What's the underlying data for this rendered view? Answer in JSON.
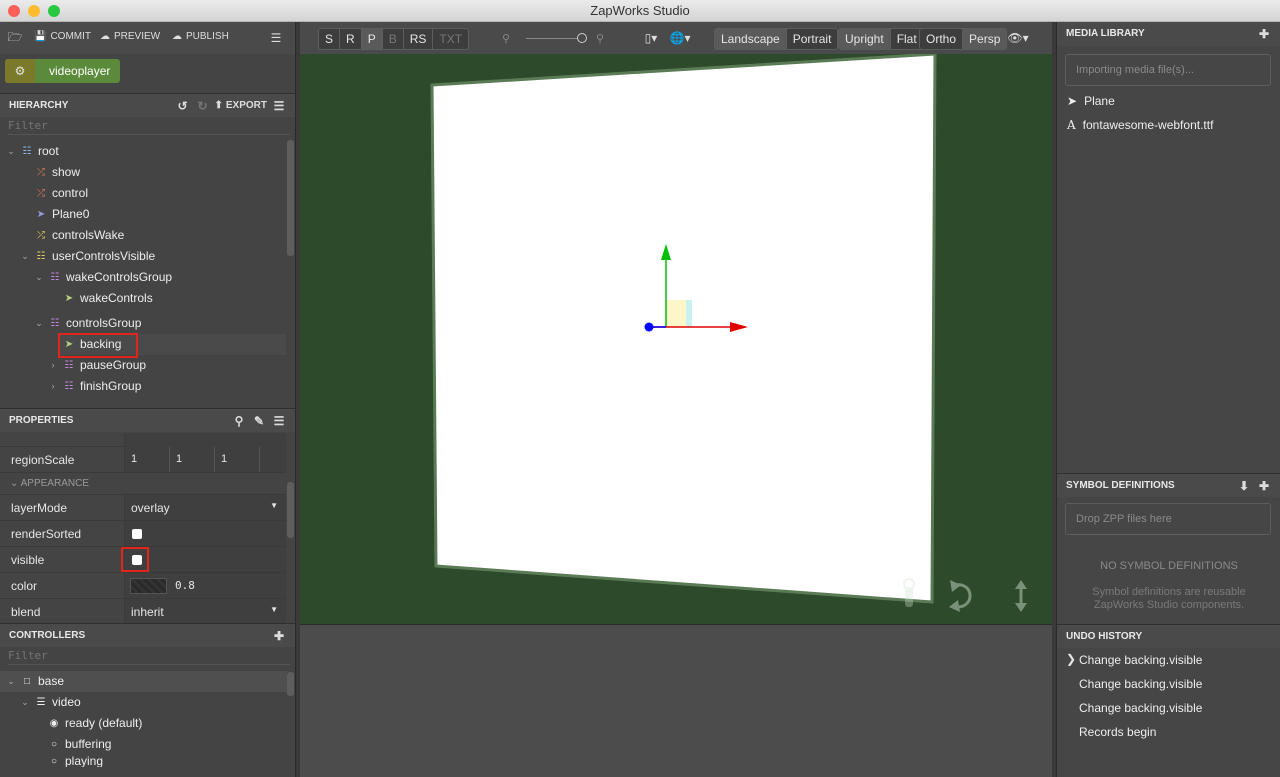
{
  "window": {
    "title": "ZapWorks Studio"
  },
  "top_actions": {
    "commit": "COMMIT",
    "preview": "PREVIEW",
    "publish": "PUBLISH"
  },
  "project": {
    "name": "videoplayer"
  },
  "hierarchy": {
    "title": "HIERARCHY",
    "export": "EXPORT",
    "filter_placeholder": "Filter",
    "items": [
      {
        "label": "root",
        "icon": "group-icon"
      },
      {
        "label": "show",
        "icon": "shuffle-icon"
      },
      {
        "label": "control",
        "icon": "shuffle-icon"
      },
      {
        "label": "Plane0",
        "icon": "rocket-icon"
      },
      {
        "label": "controlsWake",
        "icon": "shuffle-icon"
      },
      {
        "label": "userControlsVisible",
        "icon": "group-icon"
      },
      {
        "label": "wakeControlsGroup",
        "icon": "group-icon"
      },
      {
        "label": "wakeControls",
        "icon": "rocket-icon"
      },
      {
        "label": "controlsGroup",
        "icon": "group-icon"
      },
      {
        "label": "backing",
        "icon": "rocket-icon"
      },
      {
        "label": "pauseGroup",
        "icon": "group-icon"
      },
      {
        "label": "finishGroup",
        "icon": "group-icon"
      }
    ]
  },
  "properties": {
    "title": "PROPERTIES",
    "region_scale": {
      "label": "regionScale",
      "values": [
        "1",
        "1",
        "1"
      ]
    },
    "appearance_header": "APPEARANCE",
    "layer_mode": {
      "label": "layerMode",
      "value": "overlay"
    },
    "render_sorted": {
      "label": "renderSorted"
    },
    "visible": {
      "label": "visible"
    },
    "color": {
      "label": "color",
      "value": "0.8"
    },
    "blend": {
      "label": "blend",
      "value": "inherit"
    }
  },
  "controllers": {
    "title": "CONTROLLERS",
    "filter_placeholder": "Filter",
    "items": [
      {
        "label": "base"
      },
      {
        "label": "video"
      },
      {
        "label": "ready (default)"
      },
      {
        "label": "buffering"
      },
      {
        "label": "playing"
      }
    ]
  },
  "toolbar": {
    "view_buttons": [
      "S",
      "R",
      "P",
      "B",
      "RS",
      "TXT"
    ],
    "orientation": [
      "Landscape",
      "Portrait"
    ],
    "mode": [
      "Upright",
      "Flat"
    ],
    "projection": [
      "Ortho",
      "Persp"
    ]
  },
  "media_library": {
    "title": "MEDIA LIBRARY",
    "import_placeholder": "Importing media file(s)...",
    "items": [
      {
        "label": "Plane",
        "icon": "rocket-icon"
      },
      {
        "label": "fontawesome-webfont.ttf",
        "icon": "font-icon"
      }
    ]
  },
  "symbol_definitions": {
    "title": "SYMBOL DEFINITIONS",
    "drop_placeholder": "Drop ZPP files here",
    "empty_title": "NO SYMBOL DEFINITIONS",
    "empty_desc": "Symbol definitions are reusable ZapWorks Studio components."
  },
  "undo_history": {
    "title": "UNDO HISTORY",
    "items": [
      "Change backing.visible",
      "Change backing.visible",
      "Change backing.visible",
      "Records begin"
    ]
  },
  "colors": {
    "viewport_bg": "#2d4a2a",
    "project_badge": "#5a8a3a",
    "highlight": "#e0251b"
  }
}
